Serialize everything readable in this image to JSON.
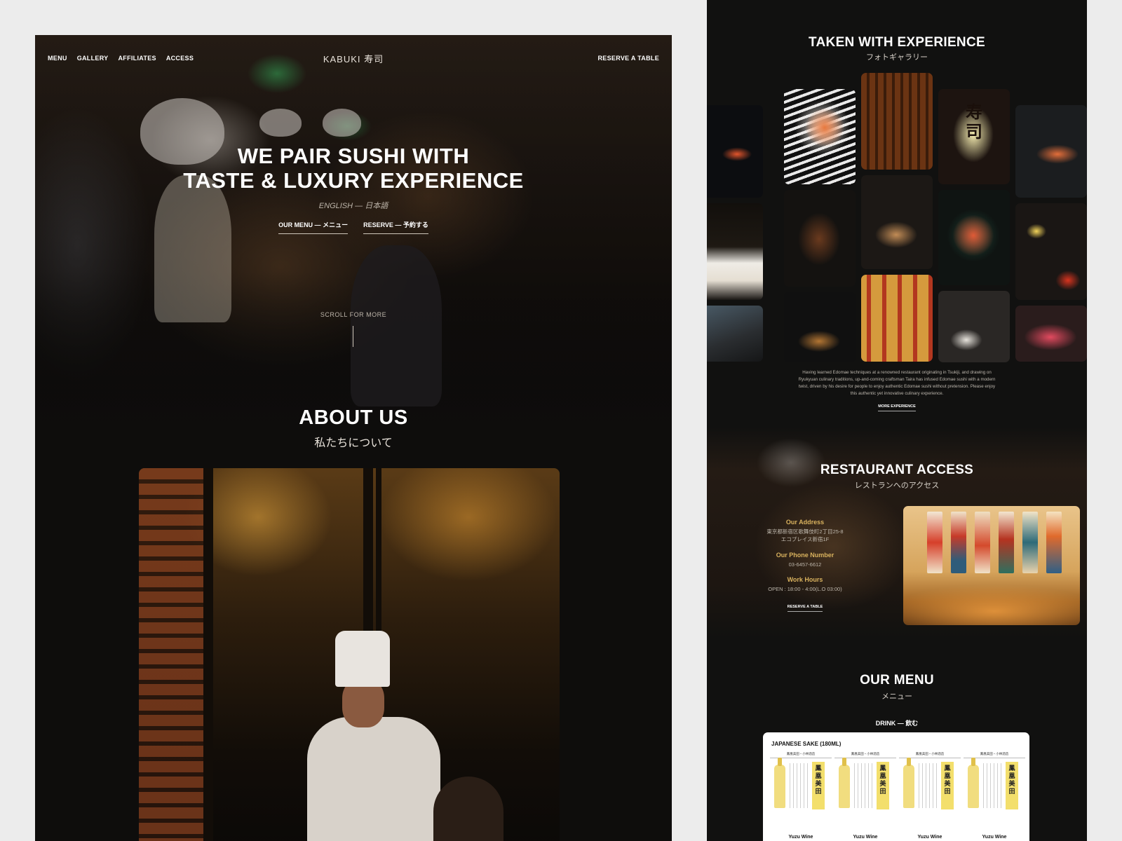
{
  "left": {
    "nav": {
      "items": [
        "MENU",
        "GALLERY",
        "AFFILIATES",
        "ACCESS"
      ],
      "logo": "KABUKI 寿司",
      "reserve": "RESERVE A TABLE"
    },
    "hero": {
      "title_line1": "WE PAIR SUSHI WITH",
      "title_line2": "TASTE & LUXURY EXPERIENCE",
      "languages": "ENGLISH — 日本語",
      "cta_menu": "OUR MENU — メニュー",
      "cta_reserve": "RESERVE — 予約する",
      "scroll": "SCROLL FOR MORE"
    },
    "about": {
      "title": "ABOUT US",
      "subtitle": "私たちについて"
    }
  },
  "right": {
    "gallery": {
      "title": "TAKEN WITH EXPERIENCE",
      "subtitle": "フォトギャラリー",
      "lantern_text": "寿司",
      "description": "Having learned Edomae techniques at a renowned restaurant originating in Tsukiji, and drawing on Ryukyuan culinary traditions, up-and-coming craftsman Taira has infused Edomae sushi with a modern twist, driven by his desire for people to enjoy authentic Edomae sushi without pretension. Please enjoy this authentic yet innovative culinary experience.",
      "more_link": "MORE EXPERIENCE"
    },
    "access": {
      "title": "RESTAURANT ACCESS",
      "subtitle": "レストランへのアクセス",
      "address_label": "Our Address",
      "address_value_1": "東京都新宿区歌舞伎町2丁目25-8",
      "address_value_2": "エコプレイス新宿1F",
      "phone_label": "Our Phone Number",
      "phone_value": "03-6457-6612",
      "hours_label": "Work Hours",
      "hours_value": "OPEN : 18:00 - 4:00(L.O 03:00)",
      "reserve": "RESERVE A TABLE"
    },
    "menu": {
      "title": "OUR MENU",
      "subtitle": "メニュー",
      "section": "DRINK — 飲む",
      "card_title": "JAPANESE SAKE (180ML)",
      "producer": "鳳凰美田・小林酒造",
      "label_text": "鳳凰美田",
      "items": [
        {
          "name": "Yuzu Wine"
        },
        {
          "name": "Yuzu Wine"
        },
        {
          "name": "Yuzu Wine"
        },
        {
          "name": "Yuzu Wine"
        }
      ]
    }
  },
  "colors": {
    "accent_gold": "#d9b25e",
    "background_dark": "#111110",
    "page_bg": "#ececec"
  }
}
